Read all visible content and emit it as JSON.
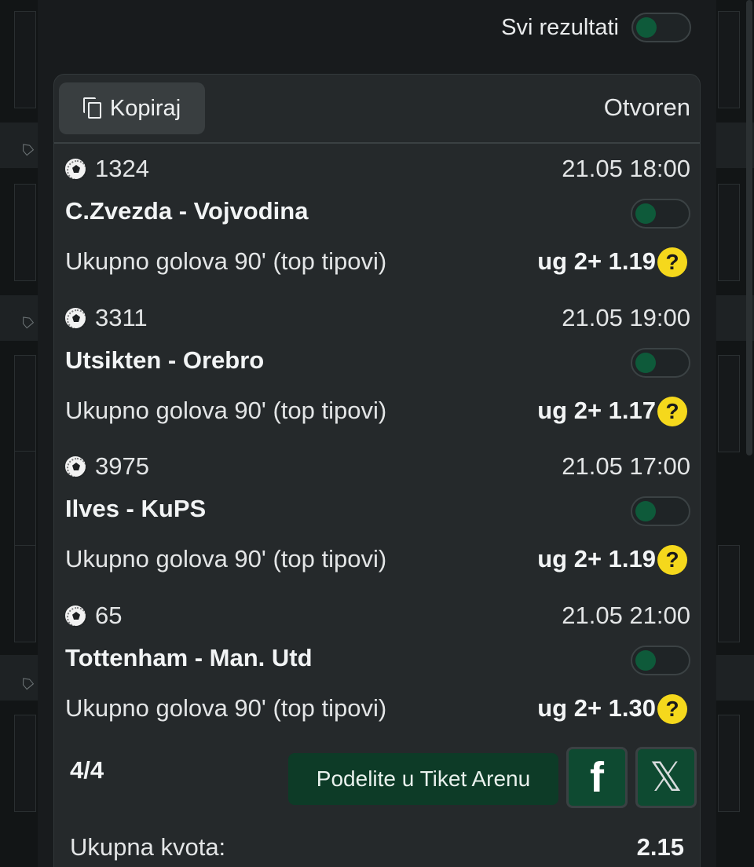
{
  "header": {
    "toggle_label": "Svi rezultati"
  },
  "ticket": {
    "copy_label": "Kopiraj",
    "status": "Otvoren",
    "matches": [
      {
        "code": "1324",
        "datetime": "21.05 18:00",
        "teams": "C.Zvezda - Vojvodina",
        "market": "Ukupno golova 90' (top tipovi)",
        "pick": "ug 2+ 1.19"
      },
      {
        "code": "3311",
        "datetime": "21.05 19:00",
        "teams": "Utsikten - Orebro",
        "market": "Ukupno golova 90' (top tipovi)",
        "pick": "ug 2+ 1.17"
      },
      {
        "code": "3975",
        "datetime": "21.05 17:00",
        "teams": "Ilves - KuPS",
        "market": "Ukupno golova 90' (top tipovi)",
        "pick": "ug 2+ 1.19"
      },
      {
        "code": "65",
        "datetime": "21.05 21:00",
        "teams": "Tottenham - Man. Utd",
        "market": "Ukupno golova 90' (top tipovi)",
        "pick": "ug 2+ 1.30"
      }
    ],
    "count": "4/4",
    "share_label": "Podelite u Tiket Arenu",
    "facebook_glyph": "f",
    "x_glyph": "𝕏",
    "total_label": "Ukupna kvota:",
    "total_value": "2.15"
  },
  "colors": {
    "accent_green": "#0e5a3a",
    "help_yellow": "#f5d81c",
    "card_bg": "#25292b"
  },
  "icons": {
    "copy": "copy-icon",
    "sport": "soccer-ball-icon",
    "help": "question-icon",
    "facebook": "facebook-icon",
    "x": "x-icon"
  }
}
